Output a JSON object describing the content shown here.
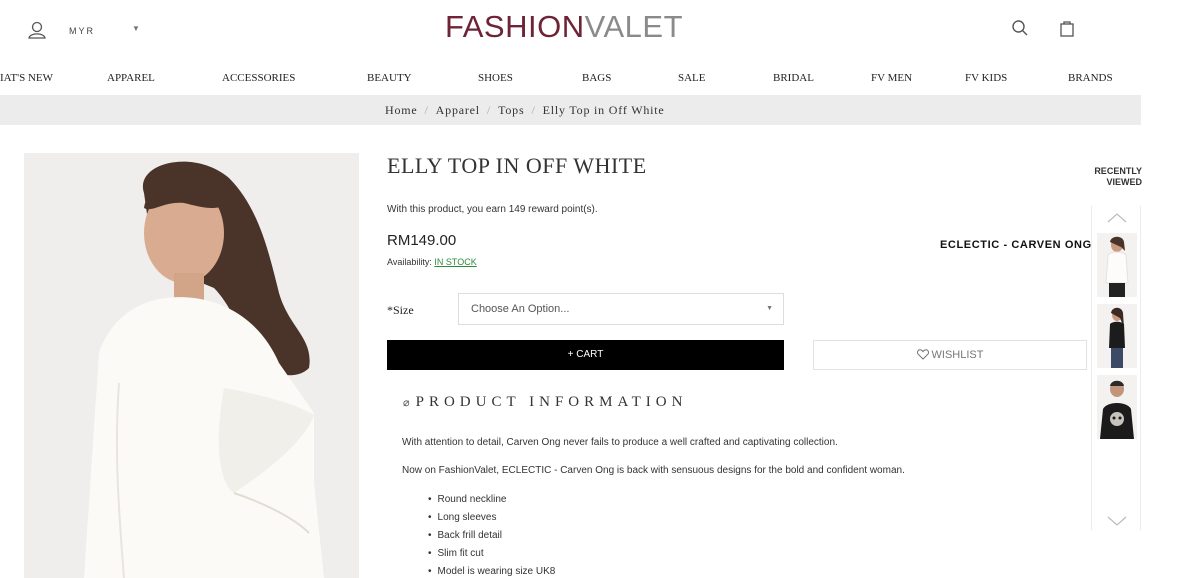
{
  "header": {
    "currency": "MYR",
    "logo_part1": "FASHION",
    "logo_part2": "VALET"
  },
  "nav": {
    "items": [
      "IAT'S NEW",
      "APPAREL",
      "ACCESSORIES",
      "BEAUTY",
      "SHOES",
      "BAGS",
      "SALE",
      "BRIDAL",
      "FV MEN",
      "FV KIDS",
      "BRANDS"
    ]
  },
  "breadcrumb": {
    "items": [
      "Home",
      "Apparel",
      "Tops",
      "Elly Top in Off White"
    ],
    "separator": "/"
  },
  "product": {
    "title": "ELLY TOP IN OFF WHITE",
    "reward_text": "With this product, you earn 149 reward point(s).",
    "price": "RM149.00",
    "availability_label": "Availability:",
    "availability_value": "IN STOCK",
    "designer": "ECLECTIC - CARVEN ONG",
    "size_label": "*Size",
    "size_placeholder": "Choose An Option...",
    "cart_label": "+ CART",
    "wishlist_label": "WISHLIST",
    "info_heading": "PRODUCT INFORMATION",
    "description_1": "With attention to detail, Carven Ong never fails to produce a well crafted and captivating collection.",
    "description_2": "Now on FashionValet, ECLECTIC - Carven Ong is back with sensuous designs for the bold and confident woman.",
    "features": [
      "Round neckline",
      "Long sleeves",
      "Back frill detail",
      "Slim fit cut",
      "Model is wearing size UK8"
    ]
  },
  "recently_viewed": {
    "title_line1": "RECENTLY",
    "title_line2": "VIEWED"
  },
  "icons": {
    "user": "user-icon",
    "search": "search-icon",
    "bag": "shopping-bag-icon",
    "wishlist": "heart-icon",
    "tag": "tag-icon"
  },
  "colors": {
    "logo_primary": "#6e2336",
    "logo_secondary": "#8a8a8a",
    "cart_button": "#000000",
    "in_stock": "#2e8b3c",
    "breadcrumb_bg": "#ececec"
  }
}
